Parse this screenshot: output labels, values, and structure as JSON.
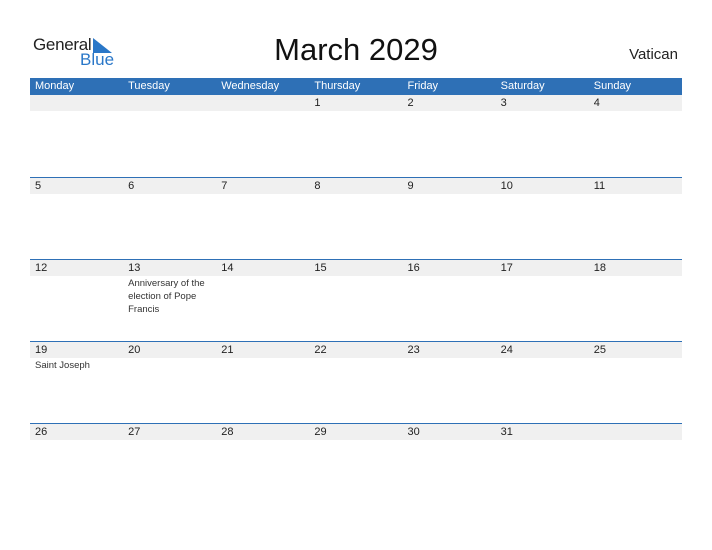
{
  "logo": {
    "general": "General",
    "blue": "Blue"
  },
  "title": "March 2029",
  "country": "Vatican",
  "weekdays": [
    "Monday",
    "Tuesday",
    "Wednesday",
    "Thursday",
    "Friday",
    "Saturday",
    "Sunday"
  ],
  "weeks": [
    {
      "days": [
        "",
        "",
        "",
        "1",
        "2",
        "3",
        "4"
      ],
      "events": [
        "",
        "",
        "",
        "",
        "",
        "",
        ""
      ]
    },
    {
      "days": [
        "5",
        "6",
        "7",
        "8",
        "9",
        "10",
        "11"
      ],
      "events": [
        "",
        "",
        "",
        "",
        "",
        "",
        ""
      ]
    },
    {
      "days": [
        "12",
        "13",
        "14",
        "15",
        "16",
        "17",
        "18"
      ],
      "events": [
        "",
        "Anniversary of the election of Pope Francis",
        "",
        "",
        "",
        "",
        ""
      ]
    },
    {
      "days": [
        "19",
        "20",
        "21",
        "22",
        "23",
        "24",
        "25"
      ],
      "events": [
        "Saint Joseph",
        "",
        "",
        "",
        "",
        "",
        ""
      ]
    },
    {
      "days": [
        "26",
        "27",
        "28",
        "29",
        "30",
        "31",
        ""
      ],
      "events": [
        "",
        "",
        "",
        "",
        "",
        "",
        ""
      ]
    }
  ],
  "colors": {
    "accent": "#2e70b6",
    "brand_blue": "#2a77c8",
    "day_row_bg": "#f0f0f0"
  }
}
